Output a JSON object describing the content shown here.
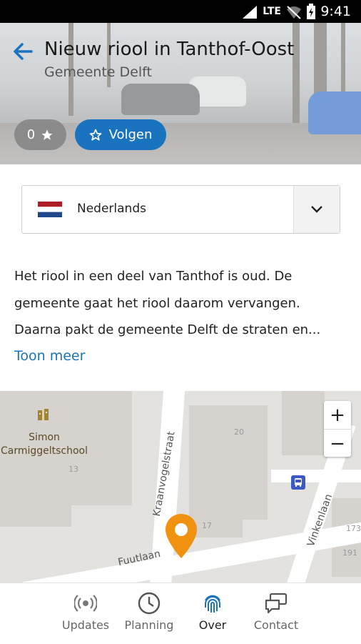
{
  "status": {
    "network": "LTE",
    "time": "9:41"
  },
  "header": {
    "title": "Nieuw riool in Tanthof-Oost",
    "subtitle": "Gemeente Delft",
    "rating_count": "0",
    "follow_label": "Volgen"
  },
  "language": {
    "selected": "Nederlands"
  },
  "description": {
    "text": "Het riool in een deel van Tanthof is oud. De gemeente gaat het riool daarom vervangen. Daarna pakt de gemeente Delft de straten en...",
    "more_label": "Toon meer"
  },
  "map": {
    "school_name": "Simon Carmiggeltschool",
    "streets": [
      "Kraanvogelstraat",
      "Fuutlaan",
      "Vinkenlaan"
    ],
    "house_numbers": [
      "20",
      "13",
      "17",
      "173",
      "191"
    ],
    "zoom_in": "+",
    "zoom_out": "−"
  },
  "nav": {
    "items": [
      {
        "label": "Updates",
        "icon": "broadcast-icon"
      },
      {
        "label": "Planning",
        "icon": "clock-icon"
      },
      {
        "label": "Over",
        "icon": "fingerprint-icon"
      },
      {
        "label": "Contact",
        "icon": "chat-icon"
      }
    ],
    "active_index": 2
  },
  "colors": {
    "accent": "#1a73bf",
    "marker": "#f0920f"
  }
}
